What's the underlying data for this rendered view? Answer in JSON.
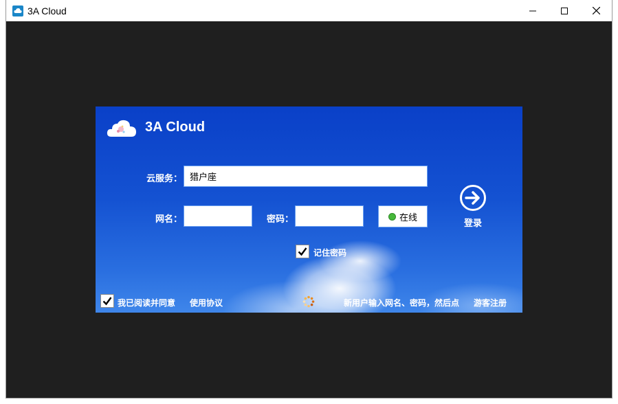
{
  "window": {
    "title": "3A Cloud",
    "controls": {
      "minimize": "minimize-icon",
      "maximize": "maximize-icon",
      "close": "close-icon"
    }
  },
  "login_panel": {
    "brand": "3A Cloud",
    "cloud_service": {
      "label": "云服务：",
      "value": "猎户座"
    },
    "username": {
      "label": "网名：",
      "value": ""
    },
    "password": {
      "label": "密码：",
      "value": ""
    },
    "status_button": "在线",
    "login_button": "登录",
    "remember_password": {
      "label": "记住密码",
      "checked": true
    },
    "agree_terms": {
      "label": "我已阅读并同意",
      "checked": true
    },
    "terms_link": "使用协议",
    "new_user_hint": "新用户输入网名、密码，然后点",
    "guest_register": "游客注册"
  },
  "colors": {
    "panel_blue": "#1452d2",
    "online_green": "#46b83a",
    "window_bg": "#1f1f1f"
  }
}
